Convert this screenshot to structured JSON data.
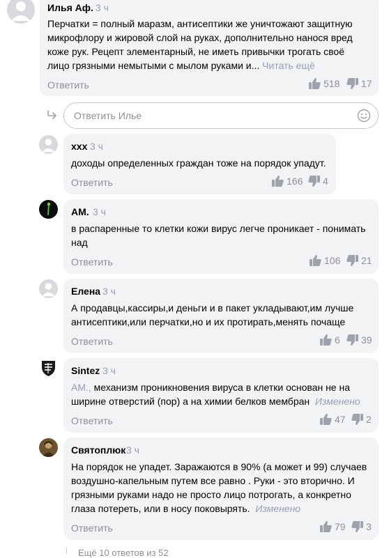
{
  "comments": [
    {
      "author": "Илья Аф.",
      "time": "3 ч",
      "lines": [
        "Перчатки = полный маразм, антисептики же уничтожают защитную",
        "микрофлору и жировой слой на руках, дополнительно нанося вред",
        "коже рук. Рецепт элементарный, не иметь привычки трогать своё",
        "лицо грязными немытыми с мылом руками и..."
      ],
      "read_more": "Читать ещё",
      "reply": "Ответить",
      "likes": "518",
      "dislikes": "17"
    },
    {
      "author": "xxx",
      "time": "3 ч",
      "lines": [
        "доходы определенных граждан тоже на порядок упадут."
      ],
      "reply": "Ответить",
      "likes": "166",
      "dislikes": "4"
    },
    {
      "author": "AM.",
      "time": "3 ч",
      "lines": [
        "в распаренные то клетки кожи вирус легче проникает - понимать",
        "над"
      ],
      "reply": "Ответить",
      "likes": "106",
      "dislikes": "21"
    },
    {
      "author": "Елена",
      "time": "3 ч",
      "lines": [
        "А продавцы,кассиры,и деньги и в пакет укладывают,им лучше",
        "антисептики,или перчатки,но и их протирать,менять почаще"
      ],
      "reply": "Ответить",
      "likes": "6",
      "dislikes": "39"
    },
    {
      "author": "Sintez",
      "time": "3 ч",
      "mention": "AM.,",
      "lines": [
        "механизм проникновения вируса в клетки основан не на",
        "ширине отверстий (пор) а на химии белков мембран"
      ],
      "edited": "Изменено",
      "reply": "Ответить",
      "likes": "47",
      "dislikes": "2"
    },
    {
      "author": "Святоплюк",
      "time": "3 ч",
      "lines": [
        "На порядок не упадет. Заражаются в 90% (а может и 99) случаев",
        "воздушно-капельным путем все равно . Руки - это вторично. И",
        "грязными руками надо не просто лицо потрогать, а конкретно",
        "глаза потереть, или в носу поковырять."
      ],
      "edited": "Изменено",
      "reply": "Ответить",
      "likes": "79",
      "dislikes": "3"
    }
  ],
  "reply_input": {
    "placeholder": "Ответить Илье"
  },
  "more_replies": "Ещё 10 ответов из 52",
  "icons": {
    "reply_arrow": "reply-arrow-icon",
    "emoji": "smiley-icon",
    "like": "thumbs-up-icon",
    "dislike": "thumbs-down-icon"
  },
  "colors": {
    "bubble": "#f2f3f5",
    "muted": "#8b9096",
    "link": "#94a0b4"
  }
}
